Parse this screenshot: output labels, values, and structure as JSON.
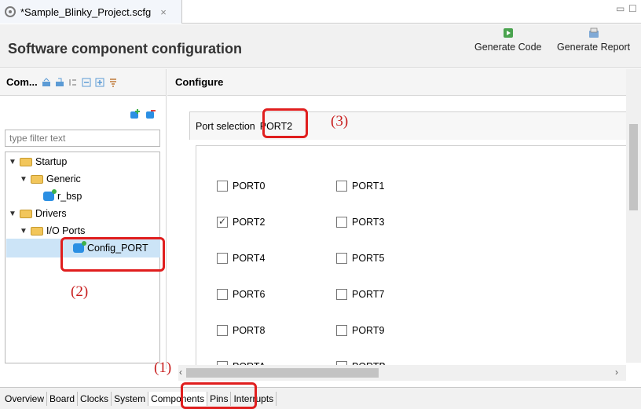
{
  "editor_tab": {
    "title": "*Sample_Blinky_Project.scfg",
    "close": "×"
  },
  "window_controls": {
    "minimize": "▭",
    "maximize": "☐"
  },
  "header": {
    "title": "Software component configuration",
    "generate_code": "Generate Code",
    "generate_report": "Generate Report"
  },
  "components": {
    "heading": "Com...",
    "filter_placeholder": "type filter text",
    "tree": {
      "startup": "Startup",
      "generic": "Generic",
      "r_bsp": "r_bsp",
      "drivers": "Drivers",
      "io_ports": "I/O Ports",
      "config_port": "Config_PORT"
    }
  },
  "configure": {
    "heading": "Configure",
    "port_selection_label": "Port selection",
    "port_selection_value": "PORT2",
    "ports": [
      {
        "label": "PORT0",
        "checked": false
      },
      {
        "label": "PORT1",
        "checked": false
      },
      {
        "label": "PORT2",
        "checked": true
      },
      {
        "label": "PORT3",
        "checked": false
      },
      {
        "label": "PORT4",
        "checked": false
      },
      {
        "label": "PORT5",
        "checked": false
      },
      {
        "label": "PORT6",
        "checked": false
      },
      {
        "label": "PORT7",
        "checked": false
      },
      {
        "label": "PORT8",
        "checked": false
      },
      {
        "label": "PORT9",
        "checked": false
      },
      {
        "label": "PORTA",
        "checked": false
      },
      {
        "label": "PORTB",
        "checked": false
      }
    ]
  },
  "bottom_tabs": [
    "Overview",
    "Board",
    "Clocks",
    "System",
    "Components",
    "Pins",
    "Interrupts"
  ],
  "active_bottom_tab": "Components",
  "annotations": {
    "a1": "(1)",
    "a2": "(2)",
    "a3": "(3)"
  },
  "colors": {
    "annotation": "#e01e1e",
    "selection": "#cce4f7"
  }
}
